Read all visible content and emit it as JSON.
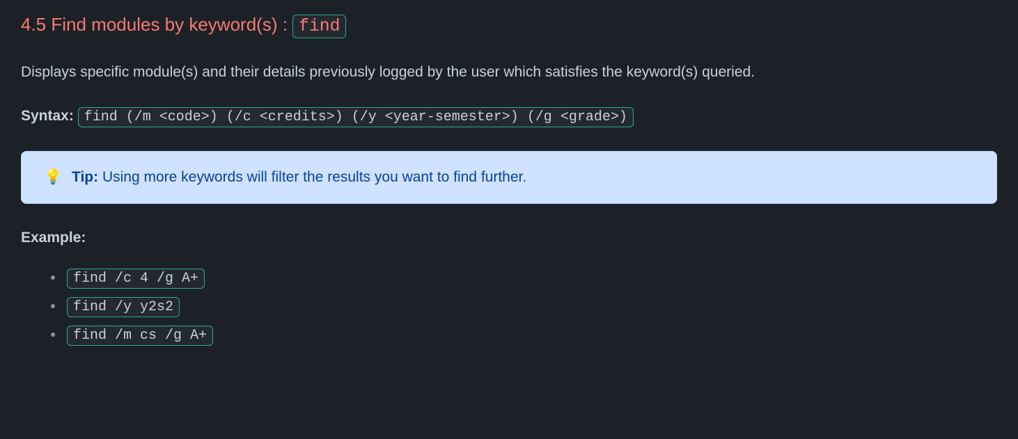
{
  "heading": {
    "number_title": "4.5 Find modules by keyword(s) : ",
    "command": "find"
  },
  "description": "Displays specific module(s) and their details previously logged by the user which satisfies the keyword(s) queried.",
  "syntax": {
    "label": "Syntax:",
    "code": "find (/m <code>) (/c <credits>) (/y <year-semester>) (/g <grade>)"
  },
  "tip": {
    "emoji": "💡",
    "label": "Tip:",
    "text": " Using more keywords will filter the results you want to find further."
  },
  "example": {
    "label": "Example:",
    "items": [
      "find /c 4 /g A+",
      "find /y y2s2",
      "find /m cs /g A+"
    ]
  }
}
